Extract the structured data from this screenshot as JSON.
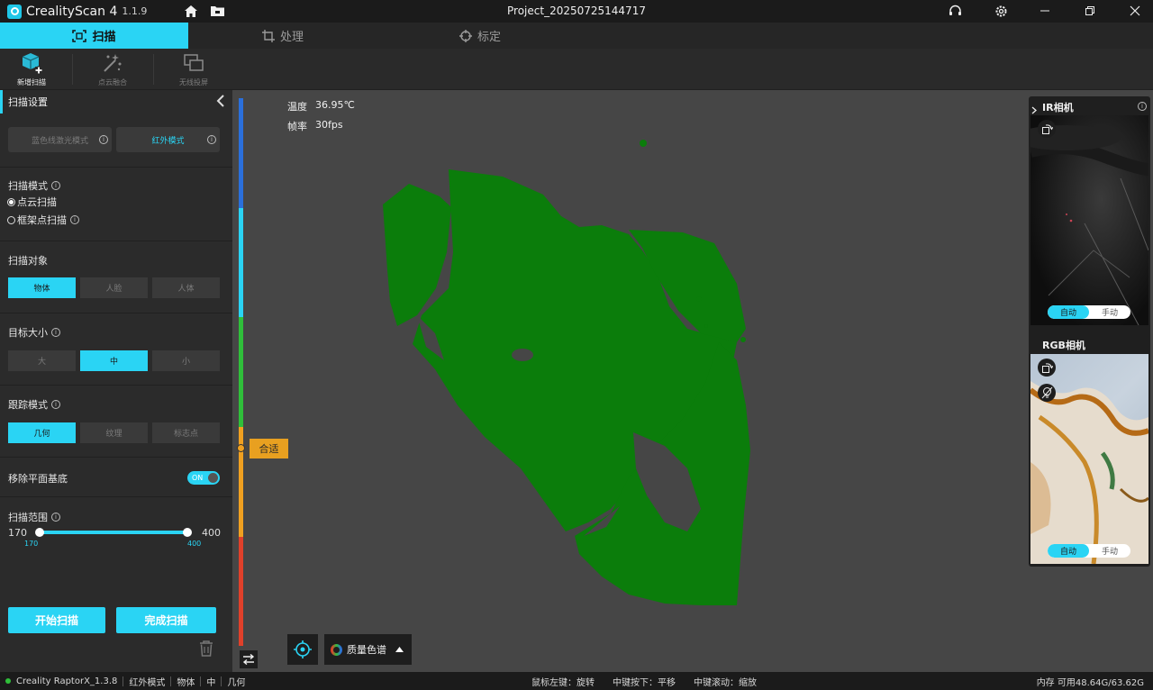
{
  "app": {
    "name": "CrealityScan 4",
    "version": "1.1.9",
    "brand_color": "#2ad4f4"
  },
  "title": "Project_20250725144717",
  "modes": [
    {
      "label": "扫描",
      "icon": "scan-frame-icon",
      "active": true
    },
    {
      "label": "处理",
      "icon": "crop-icon",
      "active": false
    },
    {
      "label": "标定",
      "icon": "crosshair-icon",
      "active": false
    }
  ],
  "tools": [
    {
      "label": "新增扫描",
      "icon": "cube-plus-icon",
      "active": true
    },
    {
      "label": "点云融合",
      "icon": "magic-wand-icon",
      "active": false
    },
    {
      "label": "无线投屏",
      "icon": "screen-cast-icon",
      "active": false
    }
  ],
  "sidebar": {
    "title": "扫描设置",
    "light_modes": [
      {
        "label": "蓝色线激光模式",
        "active": false
      },
      {
        "label": "红外模式",
        "active": true
      }
    ],
    "scan_mode": {
      "title": "扫描模式",
      "options": [
        {
          "label": "点云扫描",
          "selected": true
        },
        {
          "label": "框架点扫描",
          "selected": false
        }
      ]
    },
    "scan_object": {
      "title": "扫描对象",
      "options": [
        "物体",
        "人脸",
        "人体"
      ],
      "selected": 0
    },
    "target_size": {
      "title": "目标大小",
      "options": [
        "大",
        "中",
        "小"
      ],
      "selected": 1
    },
    "tracking_mode": {
      "title": "跟踪模式",
      "options": [
        "几何",
        "纹理",
        "标志点"
      ],
      "selected": 0
    },
    "remove_plane": {
      "label": "移除平面基底",
      "toggle": "ON"
    },
    "scan_range": {
      "title": "扫描范围",
      "min": "170",
      "max": "400",
      "low": "170",
      "high": "400"
    },
    "start_button": "开始扫描",
    "finish_button": "完成扫描"
  },
  "viewport": {
    "temperature_label": "温度",
    "temperature": "36.95℃",
    "fps_label": "帧率",
    "fps": "30fps",
    "quality_marker": "合适",
    "quality_colors": [
      "#2a6fdb",
      "#2ad4f4",
      "#2fbf3a",
      "#f0a020",
      "#e0402a"
    ],
    "point_cloud_color": "#0b7d0b",
    "color_spectrum_label": "质量色谱"
  },
  "cameras": {
    "ir": {
      "title": "IR相机",
      "auto": "自动",
      "manual": "手动"
    },
    "rgb": {
      "title": "RGB相机",
      "auto": "自动",
      "manual": "手动"
    }
  },
  "status": {
    "device": "Creality RaptorX_1.3.8",
    "mode": "红外模式",
    "object": "物体",
    "size": "中",
    "tracking": "几何",
    "hint_left": "鼠标左键：旋转",
    "hint_middle": "中键按下：平移",
    "hint_scroll": "中键滚动：缩放",
    "memory": "内存  可用48.64G/63.62G"
  }
}
